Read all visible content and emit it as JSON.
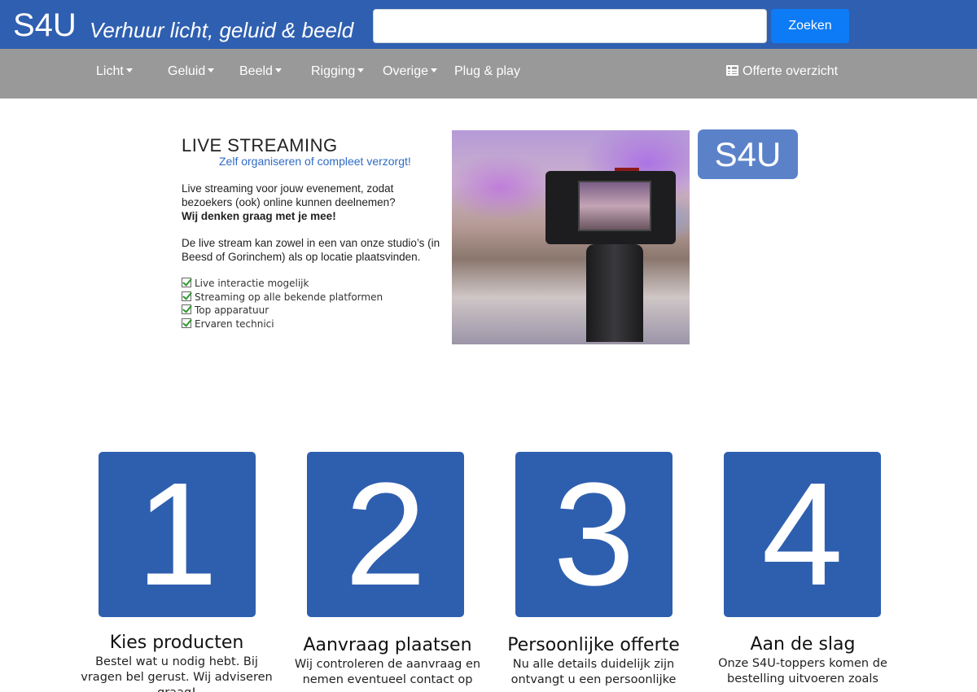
{
  "header": {
    "logo": "S4U",
    "tagline": "Verhuur licht, geluid & beeld",
    "search_placeholder": "",
    "search_button": "Zoeken"
  },
  "nav": {
    "items": [
      {
        "label": "Licht",
        "dropdown": true
      },
      {
        "label": "Geluid",
        "dropdown": true
      },
      {
        "label": "Beeld",
        "dropdown": true
      },
      {
        "label": "Rigging",
        "dropdown": true
      },
      {
        "label": "Overige",
        "dropdown": true
      },
      {
        "label": "Plug & play",
        "dropdown": false
      }
    ],
    "offerte": {
      "label": "Offerte overzicht",
      "icon": "list-icon"
    }
  },
  "promo": {
    "title": "LIVE STREAMING",
    "subtitle": "Zelf organiseren of compleet verzorgt!",
    "paragraph1": "Live streaming voor jouw evenement, zodat bezoekers (ook) online kunnen deelnemen?",
    "paragraph1_strong": "Wij denken graag met je mee!",
    "paragraph2": "De live stream kan zowel in een van onze studio’s (in Beesd of Gorinchem) als op locatie plaatsvinden.",
    "checklist": [
      "Live interactie mogelijk",
      "Streaming op alle bekende platformen",
      "Top apparatuur",
      "Ervaren technici"
    ],
    "badge": "S4U",
    "image": "camera-photo"
  },
  "steps": [
    {
      "number": "1",
      "title": "Kies producten",
      "desc": "Bestel wat u nodig hebt. Bij vragen bel gerust. Wij adviseren graag!"
    },
    {
      "number": "2",
      "title": "Aanvraag plaatsen",
      "desc": "Wij controleren de aanvraag en nemen eventueel contact op"
    },
    {
      "number": "3",
      "title": "Persoonlijke offerte",
      "desc": "Nu alle details duidelijk zijn ontvangt u een persoonlijke"
    },
    {
      "number": "4",
      "title": "Aan de slag",
      "desc": "Onze S4U-toppers komen de bestelling uitvoeren zoals"
    }
  ],
  "colors": {
    "header_bg": "#2f5fb0",
    "nav_bg": "#999999",
    "button_bg": "#0d7bf5",
    "step_bg": "#2e5faf",
    "subtitle": "#2f6bc6"
  }
}
